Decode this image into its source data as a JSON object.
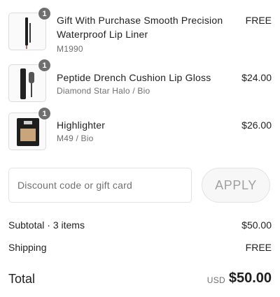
{
  "items": [
    {
      "quantity": "1",
      "title": "Gift With Purchase Smooth Precision Waterproof Lip Liner",
      "variant": "M1990",
      "price": "FREE",
      "thumbnail": "lip-liner-pencil"
    },
    {
      "quantity": "1",
      "title": "Peptide Drench Cushion Lip Gloss",
      "variant": "Diamond Star Halo / Bio",
      "price": "$24.00",
      "thumbnail": "lip-gloss-tube"
    },
    {
      "quantity": "1",
      "title": "Highlighter",
      "variant": "M49 / Bio",
      "price": "$26.00",
      "thumbnail": "highlighter-compact"
    }
  ],
  "discount": {
    "placeholder": "Discount code or gift card",
    "value": "",
    "apply_label": "APPLY"
  },
  "summary": {
    "subtotal_label": "Subtotal · 3 items",
    "subtotal_value": "$50.00",
    "shipping_label": "Shipping",
    "shipping_value": "FREE",
    "total_label": "Total",
    "total_currency": "USD",
    "total_value": "$50.00"
  },
  "colors": {
    "badge": "#6f6f6f",
    "text": "#1f1f1f",
    "muted": "#707070",
    "border": "#e3e3e3"
  }
}
